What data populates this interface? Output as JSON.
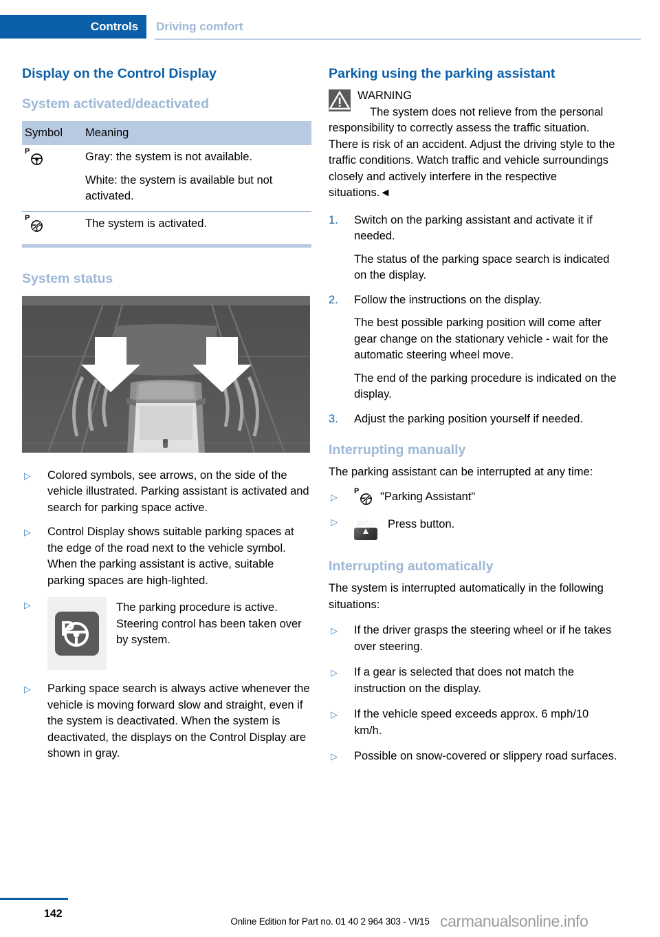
{
  "header": {
    "active_tab": "Controls",
    "inactive_tab": "Driving comfort"
  },
  "left_column": {
    "section_title": "Display on the Control Display",
    "subsection_1": "System activated/deactivated",
    "table": {
      "headers": [
        "Symbol",
        "Meaning"
      ],
      "rows": [
        {
          "symbol": "parking-assistant-steering-wheel-icon",
          "lines": [
            "Gray: the system is not available.",
            "White: the system is available but not activated."
          ]
        },
        {
          "symbol": "parking-assistant-activated-icon",
          "lines": [
            "The system is activated."
          ]
        }
      ]
    },
    "subsection_2": "System status",
    "figure_alt": "top-down-view-vehicle-with-parking-space-arrows",
    "bullets": [
      "Colored symbols, see arrows, on the side of the vehicle illustrated. Parking assistant is activated and search for parking space active.",
      "Control Display shows suitable parking spaces at the edge of the road next to the vehicle symbol. When the parking assistant is active, suitable parking spaces are high-lighted."
    ],
    "icon_bullet": {
      "icon": "parking-procedure-active-tile-icon",
      "text": "The parking procedure is active. Steering control has been taken over by system."
    },
    "bullets_after": [
      "Parking space search is always active whenever the vehicle is moving forward slow and straight, even if the system is deactivated. When the system is deactivated, the displays on the Control Display are shown in gray."
    ]
  },
  "right_column": {
    "section_title": "Parking using the parking assistant",
    "warning": {
      "label": "WARNING",
      "text": "The system does not relieve from the personal responsibility to correctly assess the traffic situation. There is risk of an accident. Adjust the driving style to the traffic conditions. Watch traffic and vehicle surroundings closely and actively interfere in the respective situations.",
      "end_mark": "◄"
    },
    "steps": [
      {
        "num": "1.",
        "text": "Switch on the parking assistant and activate it if needed.",
        "continuations": [
          "The status of the parking space search is indicated on the display."
        ]
      },
      {
        "num": "2.",
        "text": "Follow the instructions on the display.",
        "continuations": [
          "The best possible parking position will come after gear change on the stationary vehicle - wait for the automatic steering wheel move.",
          "The end of the parking procedure is indicated on the display."
        ]
      },
      {
        "num": "3.",
        "text": "Adjust the parking position yourself if needed.",
        "continuations": []
      }
    ],
    "interrupting_manually": {
      "title": "Interrupting manually",
      "intro": "The parking assistant can be interrupted at any time:",
      "items": [
        {
          "icon": "parking-assistant-activated-icon",
          "text": "\"Parking Assistant\""
        },
        {
          "icon": "pdc-button-icon",
          "text": "Press button."
        }
      ]
    },
    "interrupting_automatically": {
      "title": "Interrupting automatically",
      "intro": "The system is interrupted automatically in the following situations:",
      "bullets": [
        "If the driver grasps the steering wheel or if he takes over steering.",
        "If a gear is selected that does not match the instruction on the display.",
        "If the vehicle speed exceeds approx. 6 mph/10 km/h.",
        "Possible on snow-covered or slippery road surfaces."
      ]
    }
  },
  "footer": {
    "page_number": "142",
    "note": "Online Edition for Part no. 01 40 2 964 303 - VI/15",
    "watermark": "carmanualsonline.info"
  },
  "colors": {
    "brand_blue": "#0a5fa8",
    "light_blue": "#9db8d6",
    "table_header": "#b8cae2",
    "bullet_blue": "#2f7fc4"
  }
}
